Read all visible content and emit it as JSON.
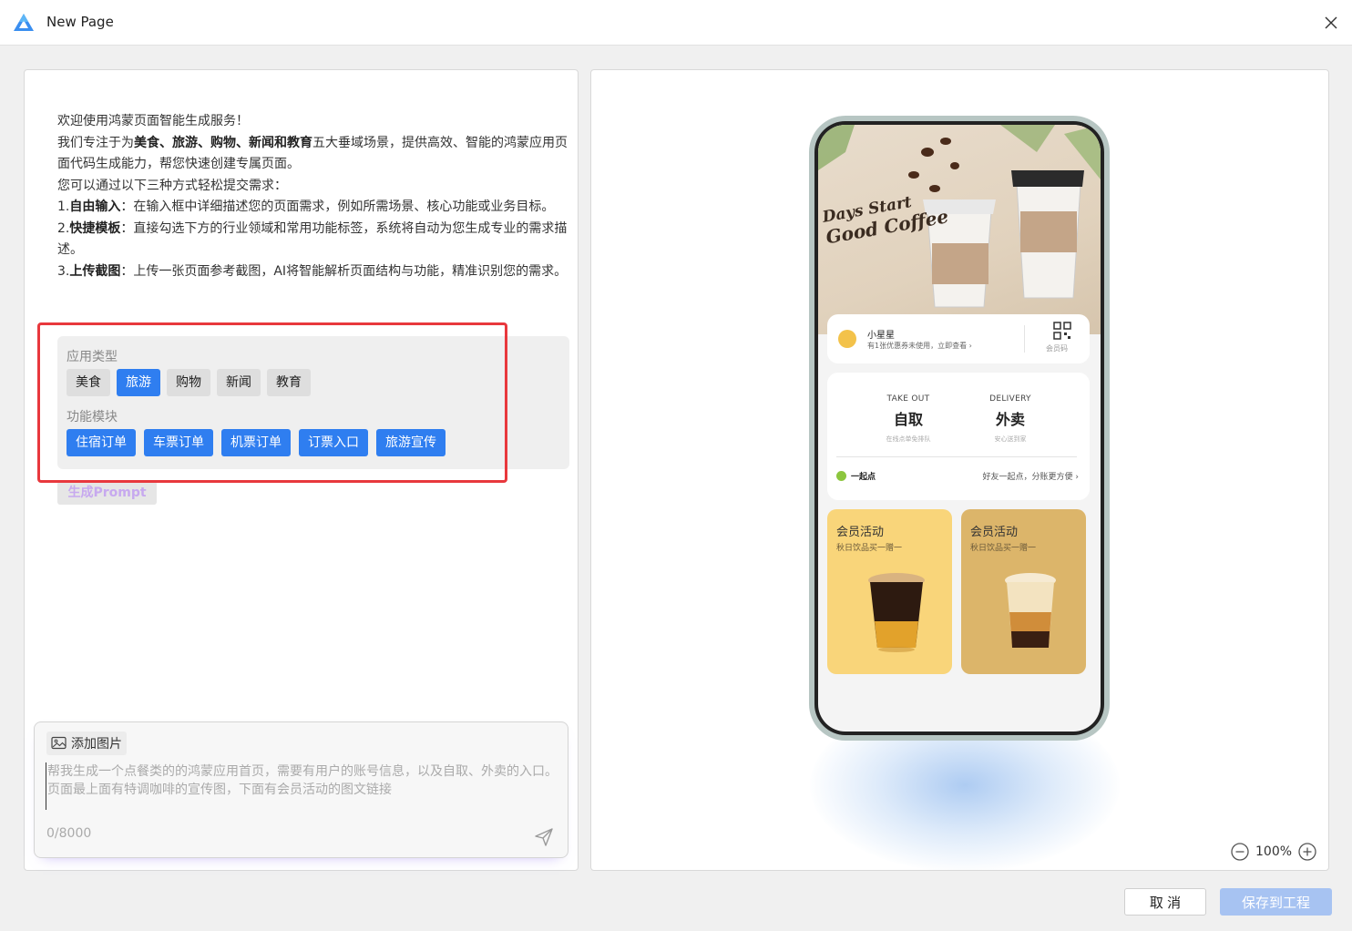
{
  "window": {
    "title": "New Page"
  },
  "intro": {
    "line1": "欢迎使用鸿蒙页面智能生成服务！",
    "line2_pre": "我们专注于为",
    "line2_bold": "美食、旅游、购物、新闻和教育",
    "line2_post": "五大垂域场景，提供高效、智能的鸿蒙应用页面代码生成能力，帮您快速创建专属页面。",
    "line3": "您可以通过以下三种方式轻松提交需求：",
    "m1_num": "1.",
    "m1_bold": "自由输入",
    "m1_text": "：在输入框中详细描述您的页面需求，例如所需场景、核心功能或业务目标。",
    "m2_num": "2.",
    "m2_bold": "快捷模板",
    "m2_text": "：直接勾选下方的行业领域和常用功能标签，系统将自动为您生成专业的需求描述。",
    "m3_num": "3.",
    "m3_bold": "上传截图",
    "m3_text": "：上传一张页面参考截图，AI将智能解析页面结构与功能，精准识别您的需求。"
  },
  "app_types": {
    "label": "应用类型",
    "items": [
      {
        "label": "美食",
        "selected": false
      },
      {
        "label": "旅游",
        "selected": true
      },
      {
        "label": "购物",
        "selected": false
      },
      {
        "label": "新闻",
        "selected": false
      },
      {
        "label": "教育",
        "selected": false
      }
    ]
  },
  "modules": {
    "label": "功能模块",
    "items": [
      {
        "label": "住宿订单",
        "selected": true
      },
      {
        "label": "车票订单",
        "selected": true
      },
      {
        "label": "机票订单",
        "selected": true
      },
      {
        "label": "订票入口",
        "selected": true
      },
      {
        "label": "旅游宣传",
        "selected": true
      }
    ]
  },
  "generate_button": "生成Prompt",
  "input": {
    "add_image": "添加图片",
    "placeholder": "帮我生成一个点餐类的的鸿蒙应用首页，需要有用户的账号信息，以及自取、外卖的入口。页面最上面有特调咖啡的宣传图，下面有会员活动的图文链接",
    "value": "",
    "char_count": "0/8000"
  },
  "preview": {
    "banner": {
      "line1": "Days Start",
      "line2": "Good Coffee"
    },
    "user": {
      "name": "小星星",
      "tip": "有1张优惠券未使用，立即查看 ›",
      "qr_label": "会员码"
    },
    "order": {
      "takeout_en": "TAKE OUT",
      "takeout_cn": "自取",
      "takeout_sub": "在线点单免排队",
      "delivery_en": "DELIVERY",
      "delivery_cn": "外卖",
      "delivery_sub": "安心送到家",
      "together_label": "一起点",
      "together_tip": "好友一起点，分账更方便 ›"
    },
    "promos": [
      {
        "title": "会员活动",
        "sub": "秋日饮品买一赠一",
        "color": "#f9d57a"
      },
      {
        "title": "会员活动",
        "sub": "秋日饮品买一赠一",
        "color": "#dcb56a"
      }
    ]
  },
  "zoom": {
    "level": "100%"
  },
  "footer": {
    "cancel": "取 消",
    "save": "保存到工程"
  },
  "colors": {
    "accent": "#2f7ef0",
    "highlight": "#e8383d",
    "save_disabled": "#a7c3f2"
  }
}
